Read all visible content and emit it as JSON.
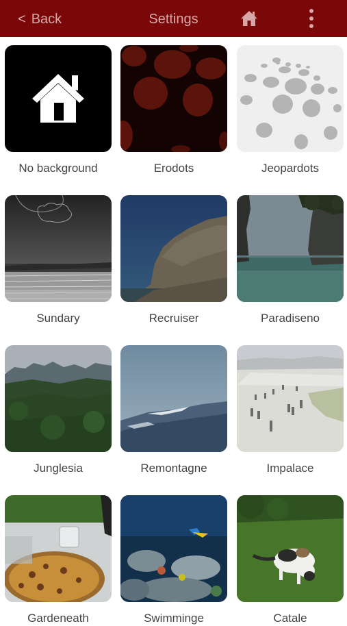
{
  "nav": {
    "back_label": "Back",
    "back_chevron": "<",
    "title": "Settings",
    "home_icon": "home-icon",
    "more_icon": "more-vertical-icon",
    "bar_color": "#7a0808",
    "text_color": "#d8a8a8"
  },
  "backgrounds": [
    {
      "label": "No background"
    },
    {
      "label": "Erodots"
    },
    {
      "label": "Jeopardots"
    },
    {
      "label": "Sundary"
    },
    {
      "label": "Recruiser"
    },
    {
      "label": "Paradiseno"
    },
    {
      "label": "Junglesia"
    },
    {
      "label": "Remontagne"
    },
    {
      "label": "Impalace"
    },
    {
      "label": "Gardeneath"
    },
    {
      "label": "Swimminge"
    },
    {
      "label": "Catale"
    }
  ]
}
